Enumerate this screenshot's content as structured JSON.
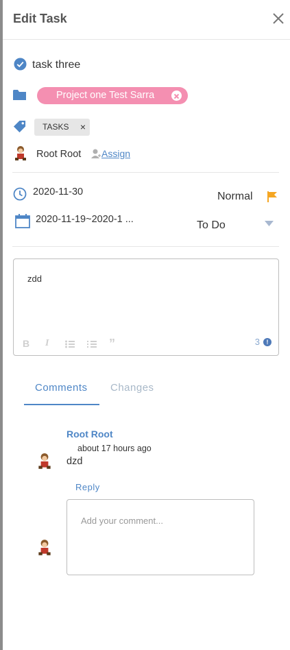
{
  "header": {
    "title": "Edit Task"
  },
  "task": {
    "name": "task three"
  },
  "project": {
    "label": "Project one Test Sarra"
  },
  "tag": {
    "label": "TASKS",
    "remove": "×"
  },
  "assignee": {
    "name": "Root Root",
    "assign_label": "Assign"
  },
  "dates": {
    "due": "2020-11-30",
    "range": "2020-11-19~2020-1 ..."
  },
  "priority": {
    "label": "Normal"
  },
  "status": {
    "label": "To Do"
  },
  "editor": {
    "content": "zdd",
    "char_count": "3",
    "tools": [
      "B",
      "I",
      "”"
    ]
  },
  "tabs": {
    "comments": "Comments",
    "changes": "Changes"
  },
  "comment": {
    "author": "Root Root",
    "time": "about 17 hours ago",
    "body": "dzd",
    "reply_label": "Reply"
  },
  "new_comment": {
    "placeholder": "Add your comment..."
  },
  "colors": {
    "accent": "#4e86c6",
    "project_chip": "#f48fb1",
    "flag": "#f5a623"
  },
  "icons": [
    "close-icon",
    "check-circle-icon",
    "folder-icon",
    "tag-icon",
    "avatar",
    "assign-user-icon",
    "clock-icon",
    "calendar-icon",
    "flag-icon",
    "caret-down-icon",
    "bold-icon",
    "italic-icon",
    "bullet-list-icon",
    "numbered-list-icon",
    "quote-icon",
    "info-icon"
  ]
}
